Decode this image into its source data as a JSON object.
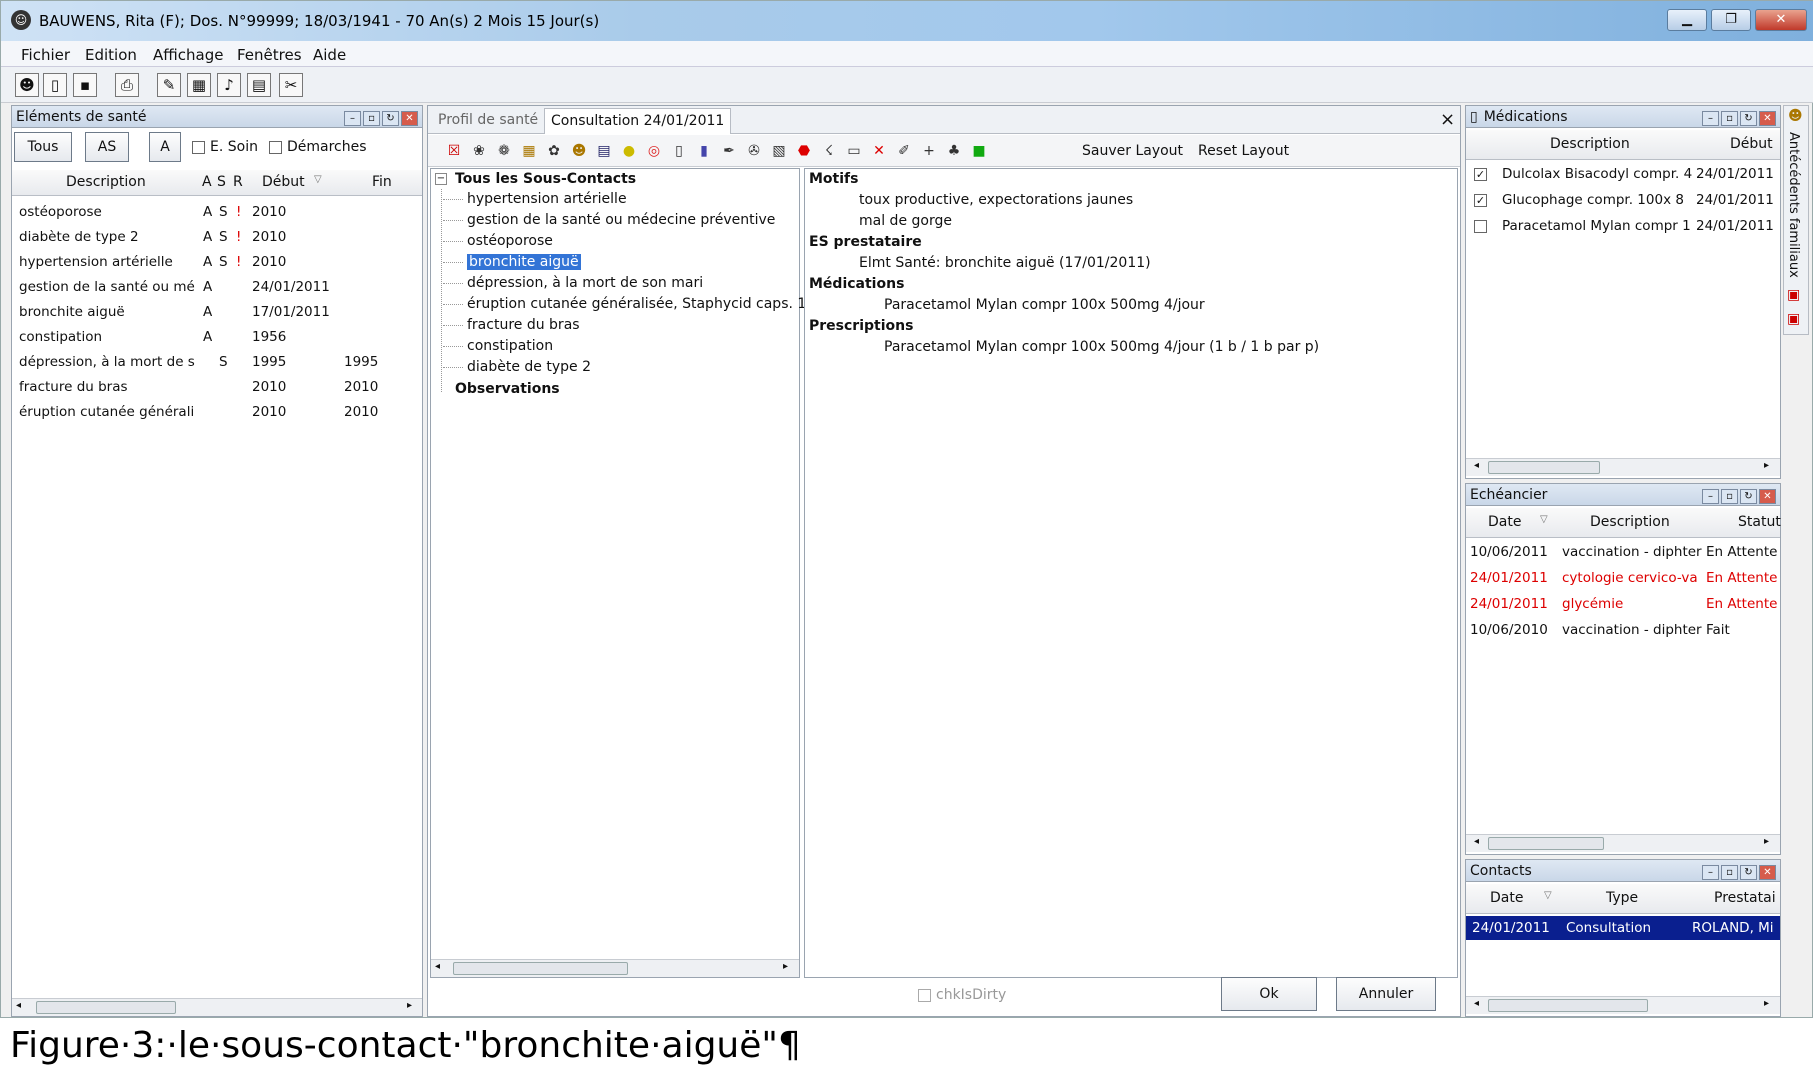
{
  "window": {
    "title": "BAUWENS, Rita (F); Dos. N°99999; 18/03/1941 - 70 An(s) 2 Mois 15 Jour(s)"
  },
  "menu": [
    "Fichier",
    "Edition",
    "Affichage",
    "Fenêtres",
    "Aide"
  ],
  "left": {
    "title": "Eléments de santé",
    "buttons": [
      "Tous",
      "AS",
      "A"
    ],
    "checks": [
      "E. Soin",
      "Démarches"
    ],
    "columns": [
      "Description",
      "A",
      "S",
      "R",
      "Début",
      "Fin"
    ],
    "rows": [
      {
        "desc": "ostéoporose",
        "a": "A",
        "s": "S",
        "r": "!",
        "debut": "2010",
        "fin": ""
      },
      {
        "desc": "diabète de type 2",
        "a": "A",
        "s": "S",
        "r": "!",
        "debut": "2010",
        "fin": ""
      },
      {
        "desc": "hypertension artérielle",
        "a": "A",
        "s": "S",
        "r": "!",
        "debut": "2010",
        "fin": ""
      },
      {
        "desc": "gestion de la santé ou mé",
        "a": "A",
        "s": "",
        "r": "",
        "debut": "24/01/2011",
        "fin": ""
      },
      {
        "desc": "bronchite aiguë",
        "a": "A",
        "s": "",
        "r": "",
        "debut": "17/01/2011",
        "fin": ""
      },
      {
        "desc": "constipation",
        "a": "A",
        "s": "",
        "r": "",
        "debut": "1956",
        "fin": ""
      },
      {
        "desc": "dépression, à la mort de s",
        "a": "",
        "s": "S",
        "r": "",
        "debut": "1995",
        "fin": "1995"
      },
      {
        "desc": "fracture du bras",
        "a": "",
        "s": "",
        "r": "",
        "debut": "2010",
        "fin": "2010"
      },
      {
        "desc": "éruption cutanée générali",
        "a": "",
        "s": "",
        "r": "",
        "debut": "2010",
        "fin": "2010"
      }
    ]
  },
  "center": {
    "tabs": [
      "Profil de santé",
      "Consultation 24/01/2011"
    ],
    "close": "×",
    "toolbar_text": [
      "Sauver Layout",
      "Reset Layout"
    ],
    "tree_root": "Tous les Sous-Contacts",
    "tree_items": [
      "hypertension artérielle",
      "gestion de la santé ou médecine préventive",
      "ostéoporose",
      "bronchite aiguë",
      "dépression, à la mort de son mari",
      "éruption cutanée généralisée, Staphycid caps. 1",
      "fracture du bras",
      "constipation",
      "diabète de type 2"
    ],
    "tree_obs": "Observations",
    "detail": [
      {
        "h": "Motifs",
        "lines": [
          "toux productive, expectorations jaunes",
          "mal de gorge"
        ],
        "indent": "a"
      },
      {
        "h": "ES prestataire",
        "lines": [
          "Elmt Santé: bronchite aiguë (17/01/2011)"
        ],
        "indent": "a"
      },
      {
        "h": "Médications",
        "lines": [
          "Paracetamol Mylan compr 100x 500mg 4/jour"
        ],
        "indent": "b"
      },
      {
        "h": "Prescriptions",
        "lines": [
          "Paracetamol Mylan compr 100x 500mg 4/jour (1 b / 1 b par p)"
        ],
        "indent": "b"
      }
    ],
    "dirty": "chkIsDirty",
    "ok": "Ok",
    "cancel": "Annuler"
  },
  "medications": {
    "title": "Médications",
    "columns": [
      "Description",
      "Début"
    ],
    "rows": [
      {
        "checked": true,
        "desc": "Dulcolax Bisacodyl compr. 4",
        "debut": "24/01/2011"
      },
      {
        "checked": true,
        "desc": "Glucophage compr. 100x 8",
        "debut": "24/01/2011"
      },
      {
        "checked": false,
        "desc": "Paracetamol Mylan compr 1",
        "debut": "24/01/2011"
      }
    ]
  },
  "side_tab": "Antécédents familiaux",
  "echeancier": {
    "title": "Echéancier",
    "columns": [
      "Date",
      "Description",
      "Statut"
    ],
    "rows": [
      {
        "date": "10/06/2011",
        "desc": "vaccination - diphter",
        "statut": "En Attente",
        "red": false
      },
      {
        "date": "24/01/2011",
        "desc": "cytologie cervico-va",
        "statut": "En Attente",
        "red": true
      },
      {
        "date": "24/01/2011",
        "desc": "glycémie",
        "statut": "En Attente",
        "red": true
      },
      {
        "date": "10/06/2010",
        "desc": "vaccination - diphter",
        "statut": "Fait",
        "red": false
      }
    ]
  },
  "contacts": {
    "title": "Contacts",
    "columns": [
      "Date",
      "Type",
      "Prestatai"
    ],
    "rows": [
      {
        "date": "24/01/2011",
        "type": "Consultation",
        "prest": "ROLAND, Mi"
      }
    ]
  },
  "caption": "Figure·3:·le·sous-contact·\"bronchite·aiguë\"¶"
}
